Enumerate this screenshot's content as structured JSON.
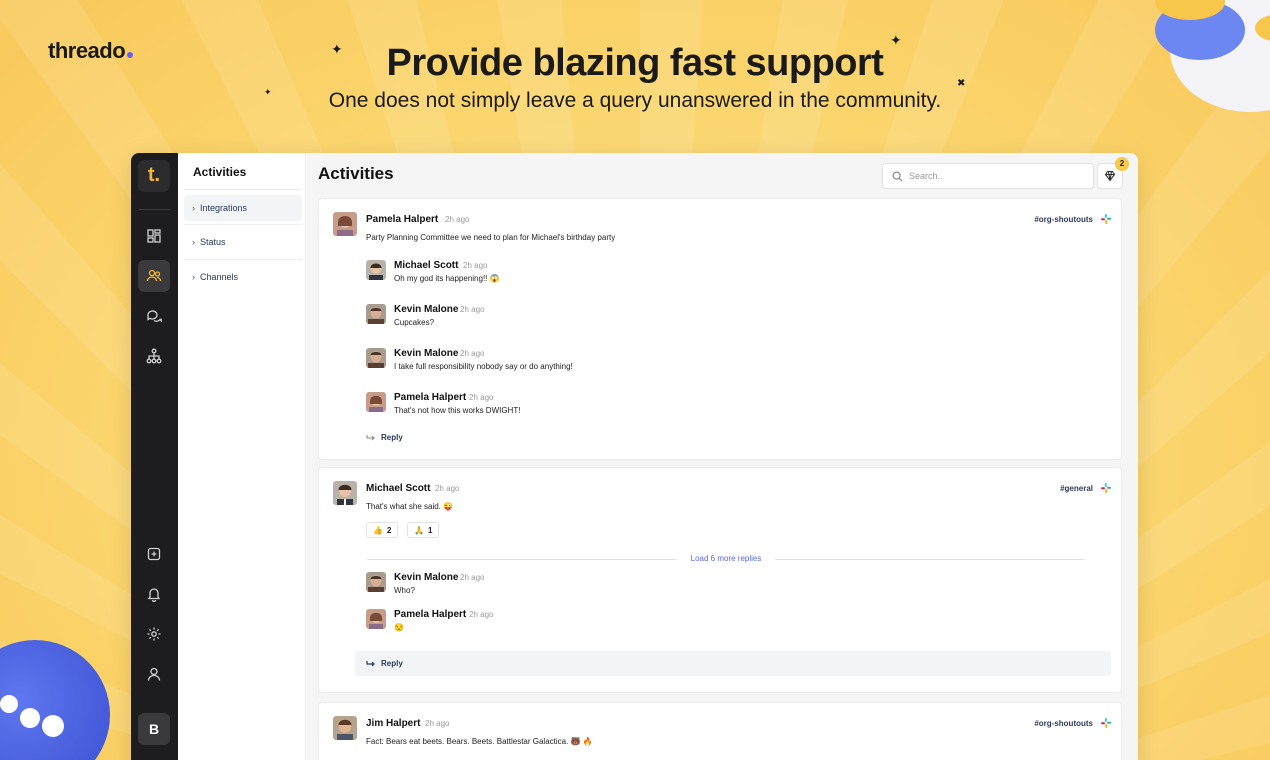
{
  "marketing": {
    "brand": "threado",
    "headline": "Provide blazing fast support",
    "subline": "One does not simply leave a query unanswered in the community."
  },
  "rail": {
    "logo": "t.",
    "avatar_initial": "B",
    "icons": [
      "dashboard-icon",
      "members-icon",
      "conversations-icon",
      "hierarchy-icon",
      "add-icon",
      "bell-icon",
      "gear-icon",
      "user-icon"
    ],
    "active": "members-icon"
  },
  "subnav": {
    "title": "Activities",
    "items": [
      {
        "label": "Integrations"
      },
      {
        "label": "Status"
      },
      {
        "label": "Channels"
      }
    ]
  },
  "main": {
    "title": "Activities",
    "search_placeholder": "Search..",
    "notification_count": "2"
  },
  "threads": [
    {
      "author": "Pamela Halpert",
      "time": "2h ago",
      "text": "Party Planning Committee we need to plan for Michael's birthday party",
      "channel": "#org-shoutouts",
      "replies": [
        {
          "author": "Michael Scott",
          "time": "2h ago",
          "text": "Oh my god its happening!! 😱"
        },
        {
          "author": "Kevin Malone",
          "time": "2h ago",
          "text": "Cupcakes?"
        },
        {
          "author": "Kevin Malone",
          "time": "2h ago",
          "text": "I take full responsibility nobody say or do anything!"
        },
        {
          "author": "Pamela Halpert",
          "time": "2h ago",
          "text": "That's not how this works DWIGHT!"
        }
      ],
      "reply_label": "Reply"
    },
    {
      "author": "Michael Scott",
      "time": "2h ago",
      "text": "That's what she said. 😜",
      "channel": "#general",
      "reactions": [
        {
          "emoji": "👍",
          "count": "2"
        },
        {
          "emoji": "🙏",
          "count": "1"
        }
      ],
      "load_more": "Load 6 more replies",
      "replies": [
        {
          "author": "Kevin Malone",
          "time": "2h ago",
          "text": "Who?"
        },
        {
          "author": "Pamela Halpert",
          "time": "2h ago",
          "text": "😒"
        }
      ],
      "reply_label": "Reply"
    },
    {
      "author": "Jim Halpert",
      "time": "2h ago",
      "text": "Fact: Bears eat beets. Bears. Beets. Battlestar Galactica. 🐻 🔥",
      "channel": "#org-shoutouts"
    }
  ],
  "colors": {
    "background": "#fbd66e",
    "rail": "#1d1d1f",
    "accent": "#f5b830",
    "link": "#5b6ad8"
  }
}
